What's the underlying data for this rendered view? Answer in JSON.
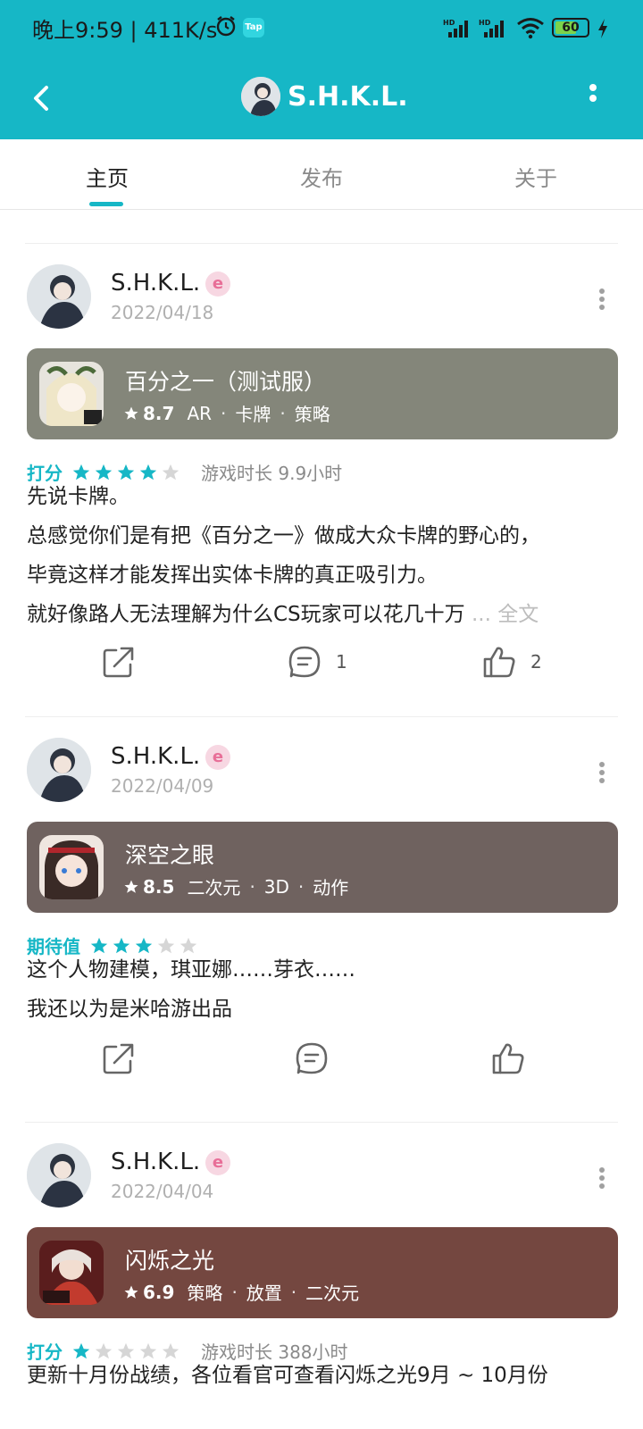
{
  "status_bar": {
    "time": "晚上9:59 | 411K/s",
    "tap_label": "Tap",
    "battery": "60",
    "network_label": "HD"
  },
  "header": {
    "title": "S.H.K.L."
  },
  "tabs": [
    {
      "label": "主页",
      "active": true
    },
    {
      "label": "发布",
      "active": false
    },
    {
      "label": "关于",
      "active": false
    }
  ],
  "posts": [
    {
      "author": "S.H.K.L.",
      "badge": "e",
      "date": "2022/04/18",
      "game": {
        "name": "百分之一（测试服）",
        "score": "8.7",
        "tags": [
          "AR",
          "卡牌",
          "策略"
        ],
        "card_color": "#84867a"
      },
      "rating_label": "打分",
      "stars": 4,
      "playtime": "游戏时长 9.9小时",
      "text_lines": [
        "先说卡牌。",
        "总感觉你们是有把《百分之一》做成大众卡牌的野心的，",
        "毕竟这样才能发挥出实体卡牌的真正吸引力。",
        "就好像路人无法理解为什么CS玩家可以花几十万"
      ],
      "more_link": "... 全文",
      "comments": "1",
      "likes": "2"
    },
    {
      "author": "S.H.K.L.",
      "badge": "e",
      "date": "2022/04/09",
      "game": {
        "name": "深空之眼",
        "score": "8.5",
        "tags": [
          "二次元",
          "3D",
          "动作"
        ],
        "card_color": "#6f625f"
      },
      "rating_label": "期待值",
      "stars": 3,
      "playtime": "",
      "text_lines": [
        "这个人物建模，琪亚娜……芽衣……",
        "我还以为是米哈游出品"
      ],
      "more_link": "",
      "comments": "",
      "likes": ""
    },
    {
      "author": "S.H.K.L.",
      "badge": "e",
      "date": "2022/04/04",
      "game": {
        "name": "闪烁之光",
        "score": "6.9",
        "tags": [
          "策略",
          "放置",
          "二次元"
        ],
        "card_color": "#744740"
      },
      "rating_label": "打分",
      "stars": 1,
      "playtime": "游戏时长 388小时",
      "text_lines": [
        "更新十月份战绩，各位看官可查看闪烁之光9月 ~ 10月份"
      ],
      "more_link": "",
      "comments": "",
      "likes": ""
    }
  ],
  "colors": {
    "accent": "#16b7c6",
    "star_on": "#16b7c6",
    "star_off": "#d6d6d6",
    "badge": "#e86f98"
  }
}
